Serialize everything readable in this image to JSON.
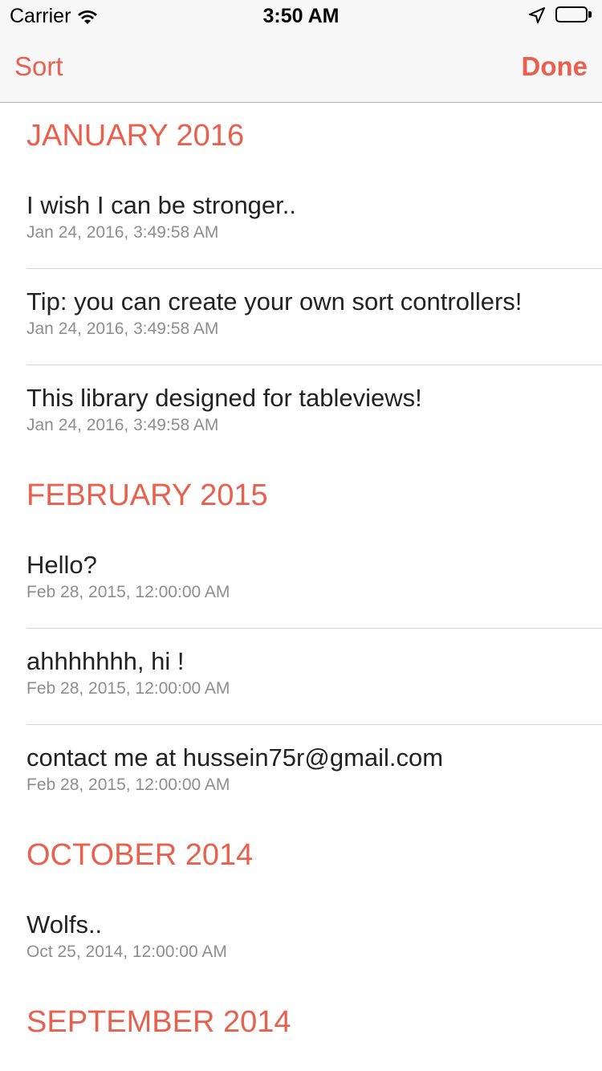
{
  "status_bar": {
    "carrier": "Carrier",
    "time": "3:50 AM",
    "wifi_icon": "wifi-icon",
    "location_icon": "location-arrow-icon",
    "battery_icon": "battery-icon"
  },
  "nav": {
    "left_label": "Sort",
    "right_label": "Done",
    "accent_color": "#e8604e"
  },
  "sections": [
    {
      "header": "JANUARY 2016",
      "rows": [
        {
          "title": "I wish I can be stronger..",
          "subtitle": "Jan 24, 2016, 3:49:58 AM"
        },
        {
          "title": "Tip: you can create your own sort controllers!",
          "subtitle": "Jan 24, 2016, 3:49:58 AM"
        },
        {
          "title": "This library designed for tableviews!",
          "subtitle": "Jan 24, 2016, 3:49:58 AM"
        }
      ]
    },
    {
      "header": "FEBRUARY 2015",
      "rows": [
        {
          "title": "Hello?",
          "subtitle": "Feb 28, 2015, 12:00:00 AM"
        },
        {
          "title": "ahhhhhhh, hi !",
          "subtitle": "Feb 28, 2015, 12:00:00 AM"
        },
        {
          "title": "contact me at hussein75r@gmail.com",
          "subtitle": "Feb 28, 2015, 12:00:00 AM"
        }
      ]
    },
    {
      "header": "OCTOBER 2014",
      "rows": [
        {
          "title": "Wolfs..",
          "subtitle": "Oct 25, 2014, 12:00:00 AM"
        }
      ]
    },
    {
      "header": "SEPTEMBER 2014",
      "rows": []
    }
  ]
}
